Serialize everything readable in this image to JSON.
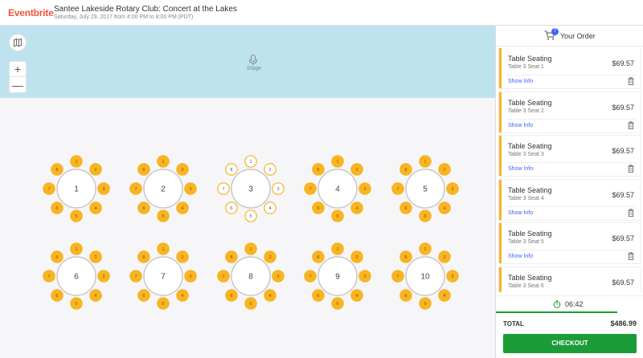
{
  "header": {
    "logo": "Eventbrite",
    "event_title": "Santee Lakeside Rotary Club: Concert at the Lakes",
    "event_date": "Saturday, July 29, 2017 from 4:00 PM to 8:00 PM (PDT)"
  },
  "map": {
    "stage_label": "Stage",
    "zoom_in": "+",
    "zoom_out": "—",
    "tables": [
      {
        "label": "1",
        "seats": [
          "1",
          "2",
          "3",
          "4",
          "5",
          "6",
          "7",
          "8"
        ],
        "selected": false
      },
      {
        "label": "2",
        "seats": [
          "1",
          "2",
          "3",
          "4",
          "5",
          "6",
          "7",
          "8"
        ],
        "selected": false
      },
      {
        "label": "3",
        "seats": [
          "1",
          "2",
          "3",
          "4",
          "5",
          "6",
          "7",
          "8"
        ],
        "selected": true
      },
      {
        "label": "4",
        "seats": [
          "1",
          "2",
          "3",
          "4",
          "5",
          "6",
          "7",
          "8"
        ],
        "selected": false
      },
      {
        "label": "5",
        "seats": [
          "1",
          "2",
          "3",
          "4",
          "5",
          "6",
          "7",
          "8"
        ],
        "selected": false
      },
      {
        "label": "6",
        "seats": [
          "1",
          "2",
          "3",
          "4",
          "5",
          "6",
          "7",
          "8"
        ],
        "selected": false
      },
      {
        "label": "7",
        "seats": [
          "1",
          "2",
          "3",
          "4",
          "5",
          "6",
          "7",
          "8"
        ],
        "selected": false
      },
      {
        "label": "8",
        "seats": [
          "1",
          "2",
          "3",
          "4",
          "5",
          "6",
          "7",
          "8"
        ],
        "selected": false
      },
      {
        "label": "9",
        "seats": [
          "1",
          "2",
          "3",
          "4",
          "5",
          "6",
          "7",
          "8"
        ],
        "selected": false
      },
      {
        "label": "10",
        "seats": [
          "1",
          "2",
          "3",
          "4",
          "5",
          "6",
          "7",
          "8"
        ],
        "selected": false
      }
    ]
  },
  "order": {
    "title": "Your Order",
    "cart_count": "7",
    "items": [
      {
        "name": "Table Seating",
        "seat": "Table 3 Seat 1",
        "price": "$69.57",
        "info": "Show Info"
      },
      {
        "name": "Table Seating",
        "seat": "Table 3 Seat 2",
        "price": "$69.57",
        "info": "Show Info"
      },
      {
        "name": "Table Seating",
        "seat": "Table 3 Seat 3",
        "price": "$69.57",
        "info": "Show Info"
      },
      {
        "name": "Table Seating",
        "seat": "Table 3 Seat 4",
        "price": "$69.57",
        "info": "Show Info"
      },
      {
        "name": "Table Seating",
        "seat": "Table 3 Seat 5",
        "price": "$69.57",
        "info": "Show Info"
      },
      {
        "name": "Table Seating",
        "seat": "Table 3 Seat 6",
        "price": "$69.57",
        "info": "Show Info"
      }
    ],
    "timer": "06:42",
    "timer_remaining_fraction": 0.82,
    "total_label": "TOTAL",
    "total_amount": "$486.99",
    "checkout_label": "CHECKOUT"
  },
  "colors": {
    "seat_fill": "#f8b421",
    "selected_seat_stroke": "#f8b421",
    "accent_orange": "#f05537",
    "checkout_green": "#1b9c36",
    "stage_blue": "#bfe2ef"
  }
}
